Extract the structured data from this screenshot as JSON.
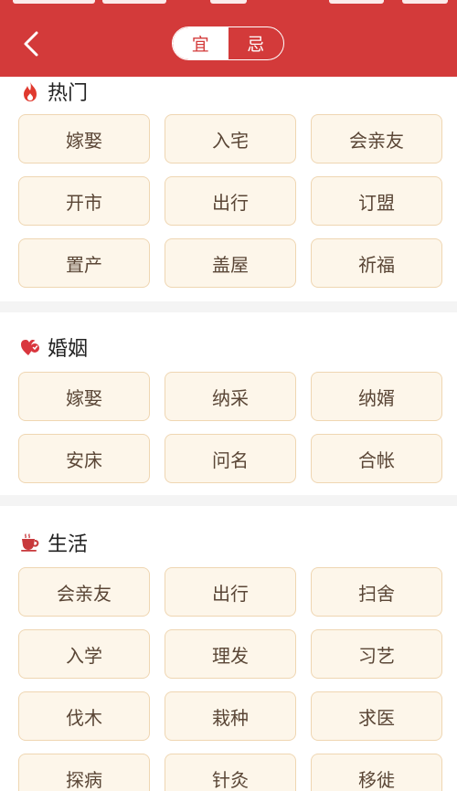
{
  "header": {
    "toggle": {
      "active": "宜",
      "inactive": "忌"
    }
  },
  "sections": [
    {
      "title": "热门",
      "icon": "fire-icon",
      "items": [
        "嫁娶",
        "入宅",
        "会亲友",
        "开市",
        "出行",
        "订盟",
        "置产",
        "盖屋",
        "祈福"
      ]
    },
    {
      "title": "婚姻",
      "icon": "heart-icon",
      "items": [
        "嫁娶",
        "纳采",
        "纳婿",
        "安床",
        "问名",
        "合帐"
      ]
    },
    {
      "title": "生活",
      "icon": "teacup-icon",
      "items": [
        "会亲友",
        "出行",
        "扫舍",
        "入学",
        "理发",
        "习艺",
        "伐木",
        "栽种",
        "求医",
        "探病",
        "针灸",
        "移徙"
      ]
    }
  ],
  "colors": {
    "accent": "#d33a3a",
    "tag_bg": "#fdf6ea",
    "tag_border": "#efd6b2",
    "tag_text": "#5a4636"
  }
}
